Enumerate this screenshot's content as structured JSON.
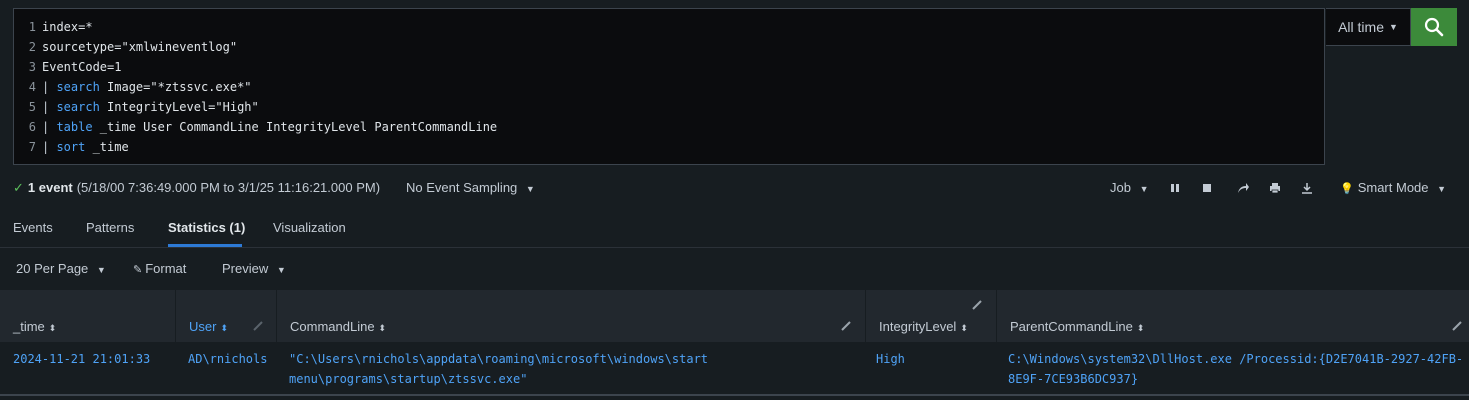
{
  "query": {
    "line_numbers": [
      "1",
      "2",
      "3",
      "4",
      "5",
      "6",
      "7"
    ],
    "lines": [
      {
        "pipe": "",
        "kw": "",
        "rest": "index=*"
      },
      {
        "pipe": "",
        "kw": "",
        "rest": "sourcetype=\"xmlwineventlog\""
      },
      {
        "pipe": "",
        "kw": "",
        "rest": "EventCode=1"
      },
      {
        "pipe": "| ",
        "kw": "search",
        "rest": " Image=\"*ztssvc.exe*\""
      },
      {
        "pipe": "| ",
        "kw": "search",
        "rest": " IntegrityLevel=\"High\""
      },
      {
        "pipe": "| ",
        "kw": "table",
        "rest": " _time User CommandLine IntegrityLevel ParentCommandLine"
      },
      {
        "pipe": "| ",
        "kw": "sort",
        "rest": " _time"
      }
    ]
  },
  "time_picker": {
    "label": "All time"
  },
  "search_button": {
    "icon": "search-icon",
    "color": "#3c8a3a"
  },
  "status": {
    "count": "1 event",
    "range": "(5/18/00 7:36:49.000 PM to 3/1/25 11:16:21.000 PM)",
    "sampling": "No Event Sampling"
  },
  "job": {
    "label": "Job",
    "mode": "Smart Mode"
  },
  "tabs": [
    {
      "label": "Events"
    },
    {
      "label": "Patterns"
    },
    {
      "label": "Statistics (1)"
    },
    {
      "label": "Visualization"
    }
  ],
  "controls": {
    "per_page": "20 Per Page",
    "format": "Format",
    "preview": "Preview"
  },
  "table": {
    "headers": [
      "_time",
      "User",
      "CommandLine",
      "IntegrityLevel",
      "ParentCommandLine"
    ],
    "rows": [
      {
        "time": "2024-11-21 21:01:33",
        "user": "AD\\rnichols",
        "cmd1": "\"C:\\Users\\rnichols\\appdata\\roaming\\microsoft\\windows\\start",
        "cmd2": "menu\\programs\\startup\\ztssvc.exe\"",
        "integrity": "High",
        "parent1": "C:\\Windows\\system32\\DllHost.exe /Processid:{D2E7041B-2927-42FB-",
        "parent2": "8E9F-7CE93B6DC937}"
      }
    ]
  },
  "accent": "#4fa3f7"
}
